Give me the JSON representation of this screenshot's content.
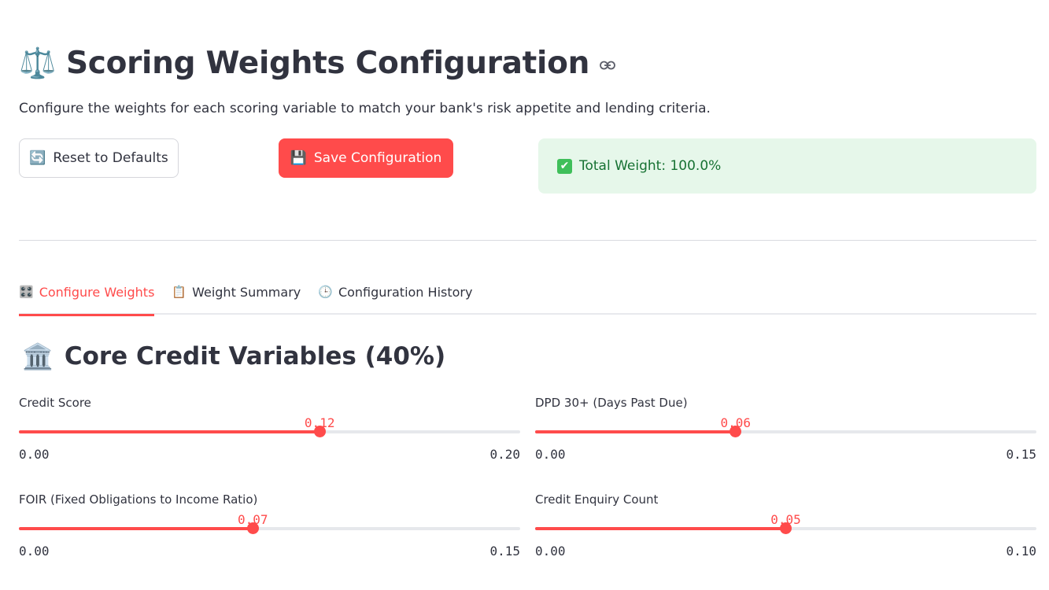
{
  "header": {
    "emoji": "⚖️",
    "title": "Scoring Weights Configuration",
    "subtitle": "Configure the weights for each scoring variable to match your bank's risk appetite and lending criteria."
  },
  "actions": {
    "reset": {
      "icon": "🔄",
      "label": "Reset to Defaults"
    },
    "save": {
      "icon": "💾",
      "label": "Save Configuration"
    }
  },
  "status": {
    "icon": "✔",
    "text": "Total Weight: 100.0%",
    "color": "#177233"
  },
  "tabs": [
    {
      "icon": "🎛️",
      "label": "Configure Weights",
      "active": true
    },
    {
      "icon": "📋",
      "label": "Weight Summary",
      "active": false
    },
    {
      "icon": "🕒",
      "label": "Configuration History",
      "active": false
    }
  ],
  "section": {
    "emoji": "🏛️",
    "title": "Core Credit Variables (40%)"
  },
  "sliders": [
    {
      "label": "Credit Score",
      "value": 0.12,
      "value_text": "0.12",
      "min": 0,
      "max": 0.2,
      "min_text": "0.00",
      "max_text": "0.20"
    },
    {
      "label": "DPD 30+ (Days Past Due)",
      "value": 0.06,
      "value_text": "0.06",
      "min": 0,
      "max": 0.15,
      "min_text": "0.00",
      "max_text": "0.15"
    },
    {
      "label": "FOIR (Fixed Obligations to Income Ratio)",
      "value": 0.07,
      "value_text": "0.07",
      "min": 0,
      "max": 0.15,
      "min_text": "0.00",
      "max_text": "0.15"
    },
    {
      "label": "Credit Enquiry Count",
      "value": 0.05,
      "value_text": "0.05",
      "min": 0,
      "max": 0.1,
      "min_text": "0.00",
      "max_text": "0.10"
    }
  ],
  "colors": {
    "accent": "#ff4b4b",
    "success_bg": "#e6f7ea",
    "text": "#31333f"
  }
}
